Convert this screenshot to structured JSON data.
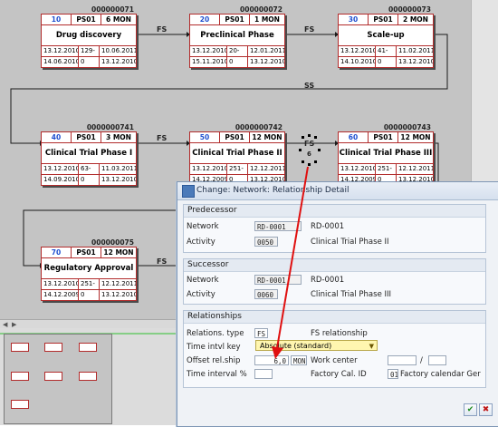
{
  "network": {
    "activities": [
      {
        "number": "000000071",
        "op": "10",
        "wc": "PS01",
        "dur": "6 MON",
        "name": "Drug discovery",
        "es": "13.12.2010",
        "fl": "129-",
        "ef": "10.06.2011",
        "ls": "14.06.2010",
        "tf": "0",
        "lf": "13.12.2010"
      },
      {
        "number": "000000072",
        "op": "20",
        "wc": "PS01",
        "dur": "1 MON",
        "name": "Preclinical Phase",
        "es": "13.12.2010",
        "fl": "20-",
        "ef": "12.01.2011",
        "ls": "15.11.2010",
        "tf": "0",
        "lf": "13.12.2010"
      },
      {
        "number": "000000073",
        "op": "30",
        "wc": "PS01",
        "dur": "2 MON",
        "name": "Scale-up",
        "es": "13.12.2010",
        "fl": "41-",
        "ef": "11.02.2011",
        "ls": "14.10.2010",
        "tf": "0",
        "lf": "13.12.2010"
      },
      {
        "number": "0000000741",
        "op": "40",
        "wc": "PS01",
        "dur": "3 MON",
        "name": "Clinical Trial Phase I",
        "es": "13.12.2010",
        "fl": "63-",
        "ef": "11.03.2011",
        "ls": "14.09.2010",
        "tf": "0",
        "lf": "13.12.2010"
      },
      {
        "number": "0000000742",
        "op": "50",
        "wc": "PS01",
        "dur": "12 MON",
        "name": "Clinical Trial Phase II",
        "es": "13.12.2010",
        "fl": "251-",
        "ef": "12.12.2011",
        "ls": "14.12.2009",
        "tf": "0",
        "lf": "13.12.2010"
      },
      {
        "number": "0000000743",
        "op": "60",
        "wc": "PS01",
        "dur": "12 MON",
        "name": "Clinical Trial Phase III",
        "es": "13.12.2010",
        "fl": "251-",
        "ef": "12.12.2011",
        "ls": "14.12.2009",
        "tf": "0",
        "lf": "13.12.2010"
      },
      {
        "number": "000000075",
        "op": "70",
        "wc": "PS01",
        "dur": "12 MON",
        "name": "Regulatory Approval",
        "es": "13.12.2010",
        "fl": "251-",
        "ef": "12.12.2011",
        "ls": "14.12.2009",
        "tf": "0",
        "lf": "13.12.2010"
      }
    ],
    "relationships": {
      "r1": "FS",
      "r2": "FS",
      "r3": "SS",
      "r4": "FS",
      "r5": "FS",
      "r5_offset": "6",
      "r6": "FS"
    }
  },
  "dialog": {
    "title": "Change: Network: Relationship Detail",
    "predecessor": {
      "group": "Predecessor",
      "network_label": "Network",
      "network": "RD-0001",
      "network_desc": "RD-0001",
      "activity_label": "Activity",
      "activity": "0050",
      "activity_desc": "Clinical Trial Phase II"
    },
    "successor": {
      "group": "Successor",
      "network_label": "Network",
      "network": "RD-0001",
      "network_desc": "RD-0001",
      "activity_label": "Activity",
      "activity": "0060",
      "activity_desc": "Clinical Trial Phase III"
    },
    "relationships": {
      "group": "Relationships",
      "type_label": "Relations. type",
      "type": "FS",
      "type_desc": "FS relationship",
      "time_key_label": "Time intvl key",
      "time_key": "Absolute (standard)",
      "offset_label": "Offset rel.ship",
      "offset": "6,0",
      "offset_unit": "MON",
      "work_center_label": "Work center",
      "work_center_sep": "/",
      "time_pct_label": "Time interval %",
      "factory_label": "Factory Cal. ID",
      "factory": "01",
      "factory_desc": "Factory calendar Ger"
    },
    "buttons": {
      "ok": "✔",
      "cancel": "✖"
    }
  },
  "colors": {
    "canvas": "#c4c4c4",
    "box_border": "#b22c2c",
    "annotation": "#e01010",
    "dialog_bg": "#eff2f6"
  }
}
